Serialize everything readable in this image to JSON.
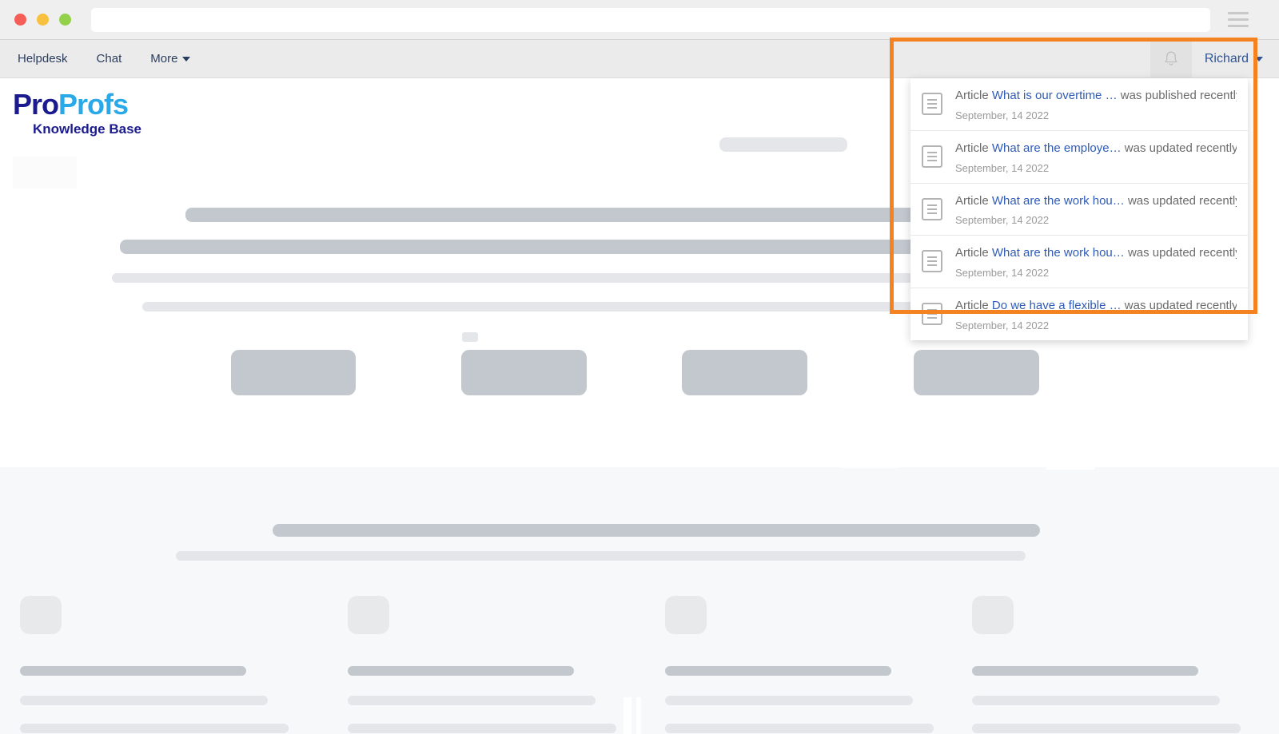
{
  "browser": {
    "address_value": "",
    "address_placeholder": "",
    "menu_icon": "hamburger-menu-icon",
    "controls": [
      "close",
      "minimize",
      "maximize"
    ]
  },
  "app_nav": {
    "items": [
      {
        "label": "Helpdesk",
        "has_caret": false
      },
      {
        "label": "Chat",
        "has_caret": false
      },
      {
        "label": "More",
        "has_caret": true
      }
    ],
    "bell_icon": "bell-icon",
    "user": {
      "name": "Richard"
    }
  },
  "logo": {
    "part1": "Pro",
    "part2": "Profs",
    "subtitle": "Knowledge Base",
    "color_part1": "#1b1b8f",
    "color_part2": "#2aa9e8"
  },
  "highlight": {
    "color": "#f58220"
  },
  "notifications": {
    "items": [
      {
        "prefix": "Article",
        "title": "What is our overtime …",
        "action": "was published recently",
        "date": "September, 14 2022",
        "icon": "document-icon"
      },
      {
        "prefix": "Article",
        "title": "What are the employe…",
        "action": "was updated recently",
        "date": "September, 14 2022",
        "icon": "document-icon"
      },
      {
        "prefix": "Article",
        "title": "What are the work hou…",
        "action": "was updated recently",
        "date": "September, 14 2022",
        "icon": "document-icon"
      },
      {
        "prefix": "Article",
        "title": "What are the work hou…",
        "action": "was updated recently",
        "date": "September, 14 2022",
        "icon": "document-icon"
      },
      {
        "prefix": "Article",
        "title": "Do we have a flexible …",
        "action": "was updated recently",
        "date": "September, 14 2022",
        "icon": "document-icon"
      }
    ]
  },
  "skeleton": {
    "note": "placeholder loading content"
  }
}
